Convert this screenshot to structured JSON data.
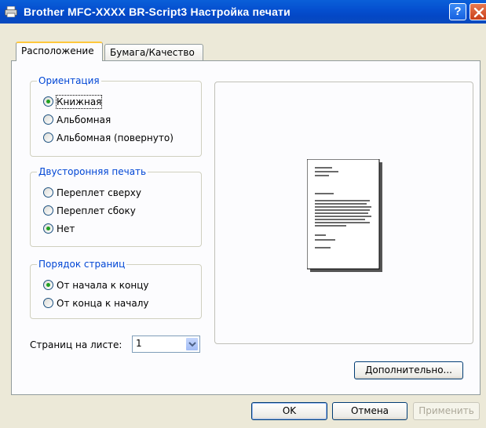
{
  "window": {
    "title": "Brother MFC-XXXX   BR-Script3 Настройка печати",
    "help_label": "?"
  },
  "tabs": [
    {
      "label": "Расположение",
      "active": true
    },
    {
      "label": "Бумага/Качество",
      "active": false
    }
  ],
  "orientation": {
    "title": "Ориентация",
    "options": [
      {
        "label": "Книжная",
        "selected": true
      },
      {
        "label": "Альбомная",
        "selected": false
      },
      {
        "label": "Альбомная (повернуто)",
        "selected": false
      }
    ]
  },
  "duplex": {
    "title": "Двусторонняя печать",
    "options": [
      {
        "label": "Переплет сверху",
        "selected": false
      },
      {
        "label": "Переплет сбоку",
        "selected": false
      },
      {
        "label": "Нет",
        "selected": true
      }
    ]
  },
  "page_order": {
    "title": "Порядок страниц",
    "options": [
      {
        "label": "От начала к концу",
        "selected": true
      },
      {
        "label": "От конца к началу",
        "selected": false
      }
    ]
  },
  "pages_per_sheet": {
    "label": "Страниц на листе:",
    "value": "1"
  },
  "buttons": {
    "advanced": "Дополнительно...",
    "ok": "OK",
    "cancel": "Отмена",
    "apply": "Применить"
  },
  "colors": {
    "titlebar": "#0550d0",
    "group_title": "#0046d5",
    "radio_selected": "#21a121",
    "dialog_bg": "#ece9d8"
  }
}
